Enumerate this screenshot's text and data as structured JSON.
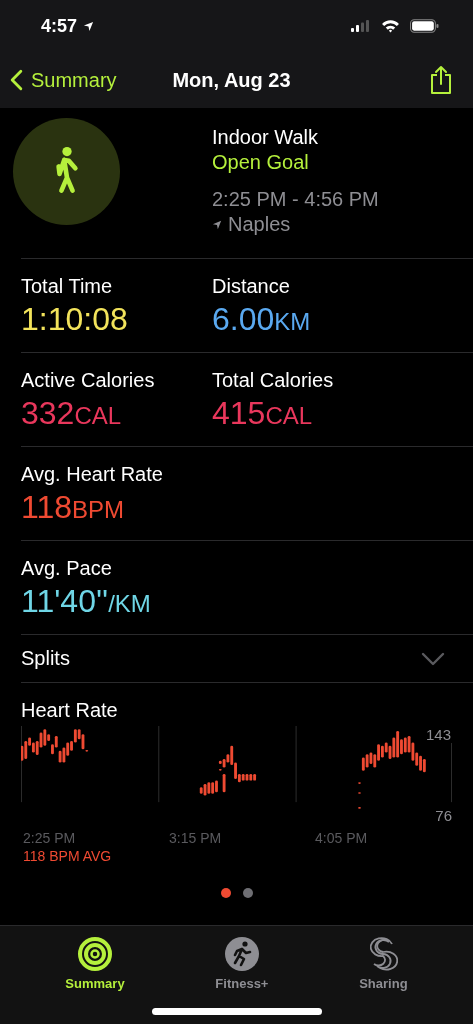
{
  "status_bar": {
    "time": "4:57"
  },
  "nav": {
    "back": "Summary",
    "title": "Mon, Aug 23"
  },
  "workout": {
    "name": "Indoor Walk",
    "goal": "Open Goal",
    "time_range": "2:25 PM - 4:56 PM",
    "location": "Naples"
  },
  "metric_rows": [
    {
      "items": [
        {
          "label": "Total Time",
          "value": "1:10:08",
          "color": "#f2e35b"
        },
        {
          "label": "Distance",
          "value": "6.00",
          "unit": "KM",
          "color": "#5aa9f0"
        }
      ]
    },
    {
      "items": [
        {
          "label": "Active Calories",
          "value": "332",
          "unit": "CAL",
          "color": "#e9375c"
        },
        {
          "label": "Total Calories",
          "value": "415",
          "unit": "CAL",
          "color": "#e9375c"
        }
      ]
    },
    {
      "items": [
        {
          "label": "Avg. Heart Rate",
          "value": "118",
          "unit": "BPM",
          "color": "#ef4a32"
        }
      ]
    },
    {
      "items": [
        {
          "label": "Avg. Pace",
          "value": "11'40''",
          "unit": "/KM",
          "color": "#6fd6e6"
        }
      ]
    }
  ],
  "splits": {
    "label": "Splits",
    "expanded": false
  },
  "heart_rate": {
    "title": "Heart Rate",
    "max": "143",
    "min": "76",
    "times": [
      "2:25 PM",
      "3:15 PM",
      "4:05 PM"
    ],
    "average": "118 BPM AVG"
  },
  "pages": [
    {
      "selected": true
    },
    {
      "selected": false
    }
  ],
  "tabs": [
    {
      "label": "Summary",
      "kind": "rings",
      "selected": true
    },
    {
      "label": "Fitness+",
      "kind": "runner",
      "selected": false
    },
    {
      "label": "Sharing",
      "kind": "sharing",
      "selected": false
    }
  ]
}
